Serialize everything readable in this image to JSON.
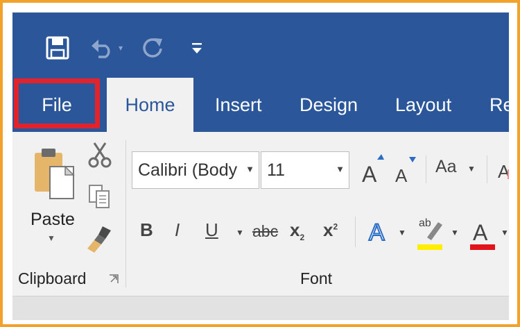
{
  "colors": {
    "frame_border": "#f2a22a",
    "ribbon_blue": "#2b579a",
    "file_highlight": "#e3232b",
    "highlight_yellow": "#ffee00",
    "font_color_red": "#e3131b"
  },
  "quick_access": {
    "save_icon": "save-icon",
    "undo_icon": "undo-icon",
    "redo_icon": "redo-icon",
    "customize_icon": "customize-qat-icon"
  },
  "tabs": {
    "file": "File",
    "home": "Home",
    "insert": "Insert",
    "design": "Design",
    "layout": "Layout",
    "references": "Re"
  },
  "clipboard": {
    "paste_label": "Paste",
    "group_label": "Clipboard"
  },
  "font": {
    "font_name": "Calibri (Body",
    "font_size": "11",
    "bold": "B",
    "italic": "I",
    "underline": "U",
    "strikethrough": "abc",
    "subscript_main": "x",
    "subscript_index": "2",
    "superscript_main": "x",
    "superscript_index": "2",
    "change_case": "Aa",
    "group_label": "Font"
  }
}
